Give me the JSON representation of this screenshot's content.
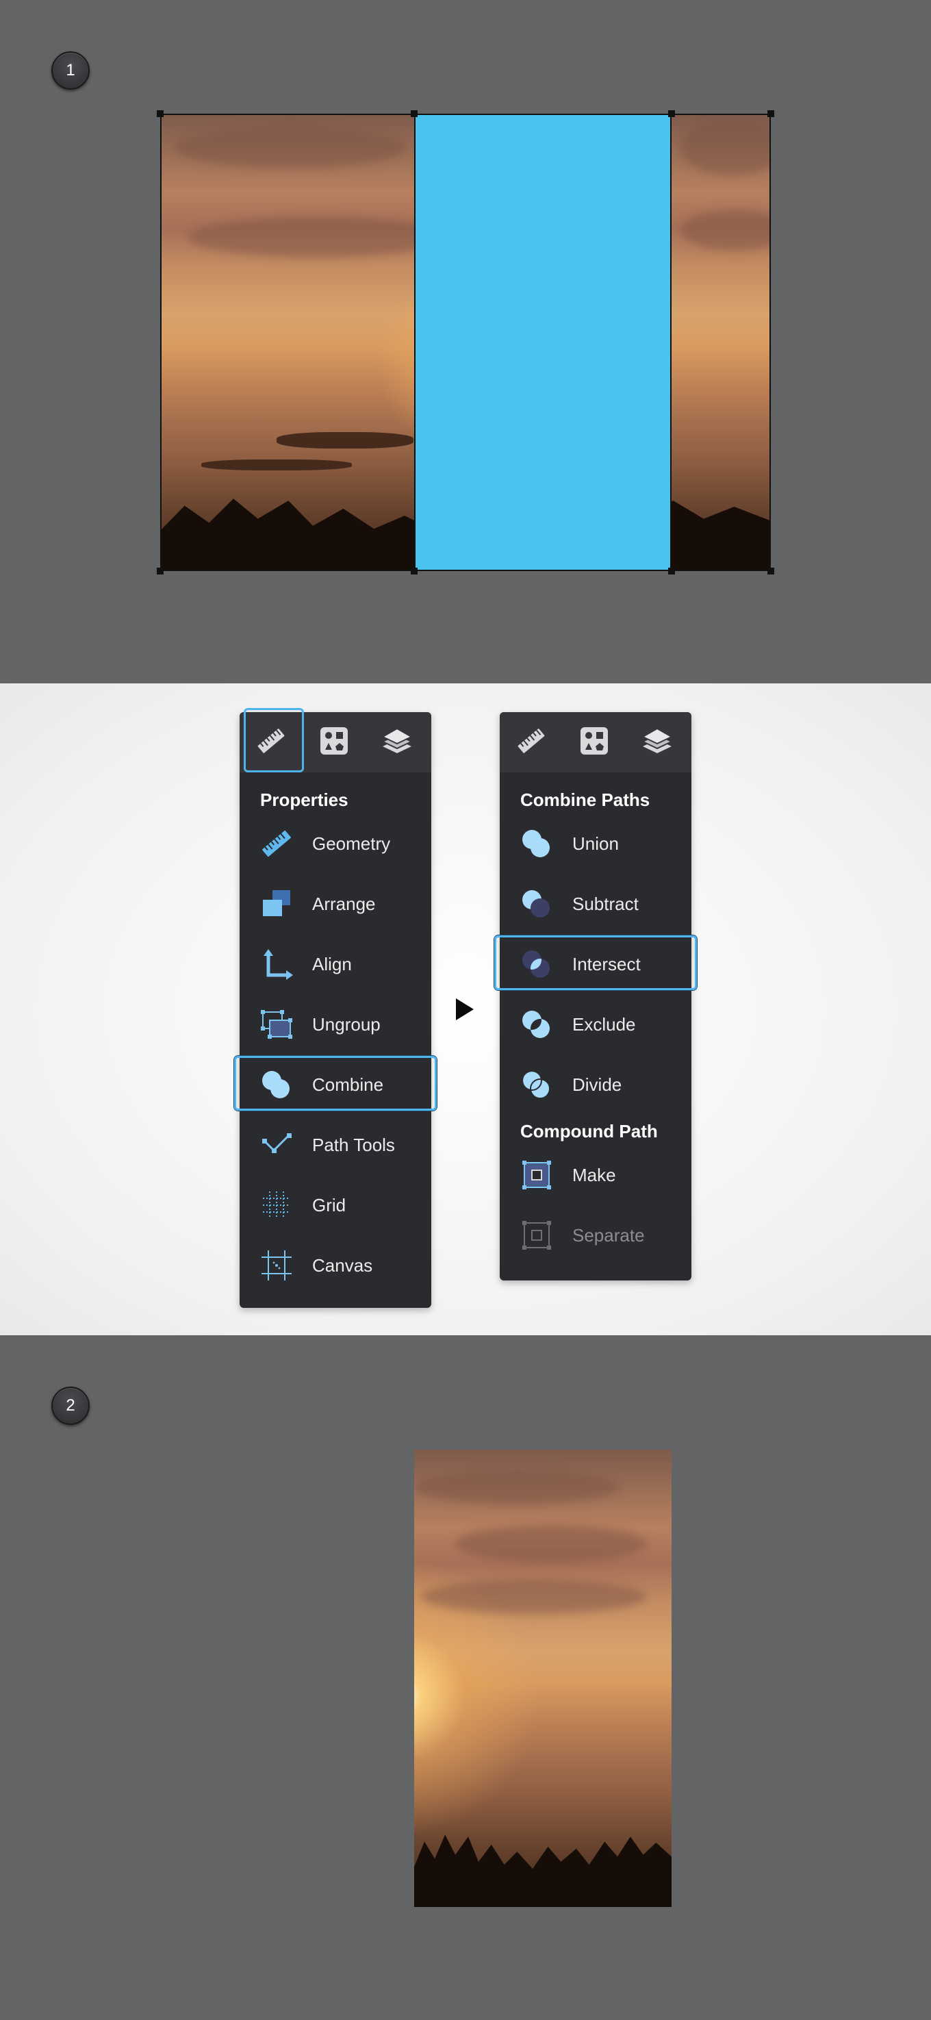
{
  "steps": {
    "first": "1",
    "second": "2"
  },
  "properties_menu": {
    "section_title": "Properties",
    "tabs": [
      "ruler-icon",
      "shapes-icon",
      "layers-icon"
    ],
    "items": [
      {
        "label": "Geometry",
        "icon": "ruler-icon"
      },
      {
        "label": "Arrange",
        "icon": "arrange-icon"
      },
      {
        "label": "Align",
        "icon": "align-icon"
      },
      {
        "label": "Ungroup",
        "icon": "ungroup-icon"
      },
      {
        "label": "Combine",
        "icon": "combine-icon",
        "selected": true
      },
      {
        "label": "Path Tools",
        "icon": "path-tools-icon"
      },
      {
        "label": "Grid",
        "icon": "grid-icon"
      },
      {
        "label": "Canvas",
        "icon": "canvas-icon"
      }
    ]
  },
  "combine_menu": {
    "section_title": "Combine Paths",
    "section2_title": "Compound Path",
    "items": [
      {
        "label": "Union",
        "icon": "union-icon"
      },
      {
        "label": "Subtract",
        "icon": "subtract-icon"
      },
      {
        "label": "Intersect",
        "icon": "intersect-icon",
        "selected": true
      },
      {
        "label": "Exclude",
        "icon": "exclude-icon"
      },
      {
        "label": "Divide",
        "icon": "divide-icon"
      }
    ],
    "compound_items": [
      {
        "label": "Make",
        "icon": "make-icon"
      },
      {
        "label": "Separate",
        "icon": "separate-icon",
        "disabled": true
      }
    ]
  },
  "colors": {
    "accent": "#4fb3f0",
    "shape_fill": "#4ac3ee",
    "canvas_bg": "#636466",
    "menu_bg": "#2a2b2e"
  }
}
